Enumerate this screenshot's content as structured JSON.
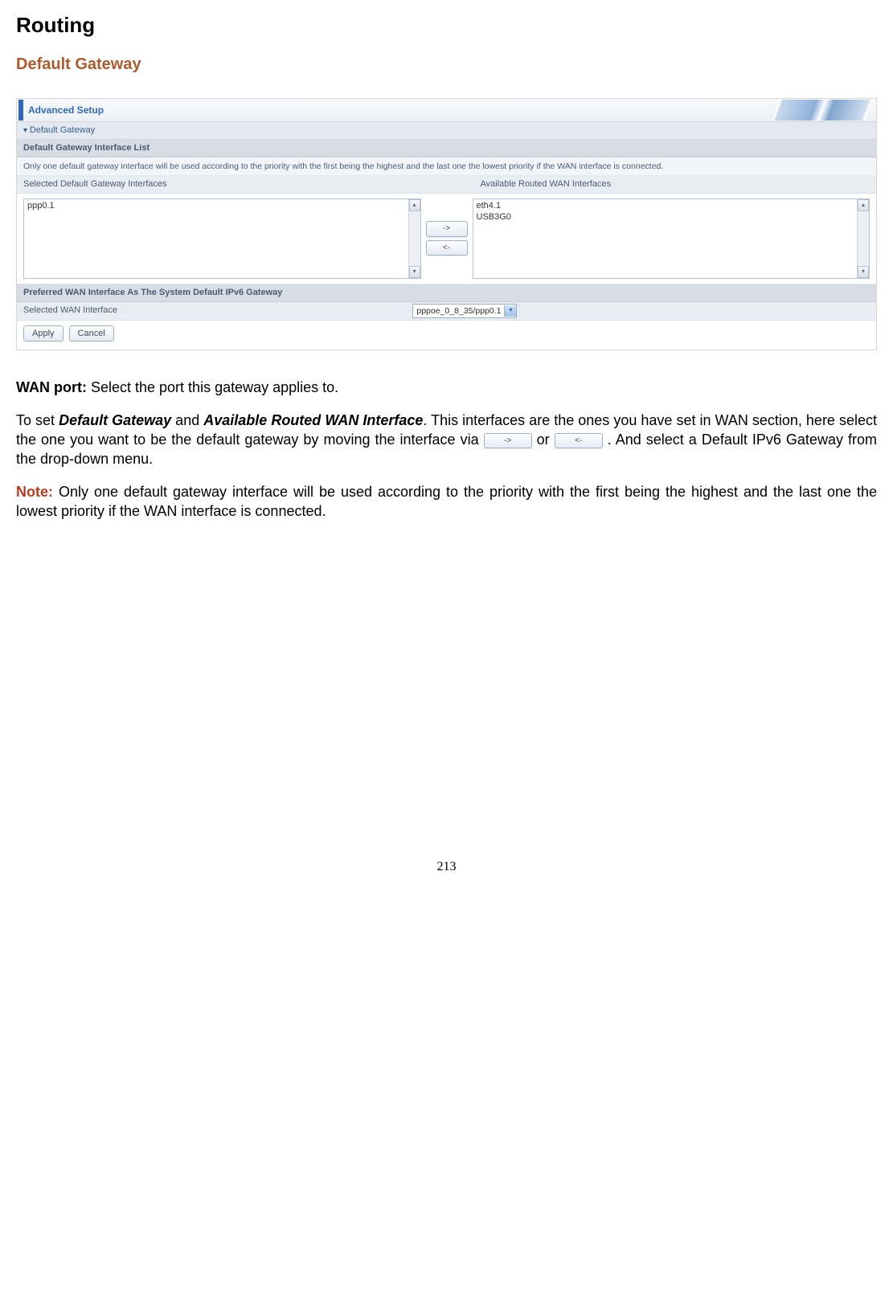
{
  "heading": "Routing",
  "subheading": "Default Gateway",
  "panel": {
    "header": "Advanced Setup",
    "section_arrow": "Default Gateway",
    "section_sub": "Default Gateway Interface List",
    "help_text": "Only one default gateway interface will be used according to the priority with the first being the highest and the last one the lowest priority if the WAN interface is connected.",
    "col_left_label": "Selected Default Gateway Interfaces",
    "col_right_label": "Available Routed WAN Interfaces",
    "left_list": [
      "ppp0.1"
    ],
    "right_list": [
      "eth4.1",
      "USB3G0"
    ],
    "btn_right": "->",
    "btn_left": "<-",
    "ipv6_section": "Preferred WAN Interface As The System Default IPv6 Gateway",
    "ipv6_label": "Selected WAN Interface",
    "ipv6_value": "pppoe_0_8_35/ppp0.1",
    "apply": "Apply",
    "cancel": "Cancel"
  },
  "body": {
    "wan_port_label": "WAN port:",
    "wan_port_text": " Select the port this gateway applies to.",
    "para2_pre": "To set ",
    "para2_dg": "Default Gateway",
    "para2_and": " and ",
    "para2_arwi": "Available Routed WAN Interface",
    "para2_mid": ". This interfaces are the ones you have set in WAN section, here select the one you want to be the default gateway by moving the interface via ",
    "para2_or": " or ",
    "para2_end": " .  And select a Default IPv6 Gateway from the drop-down menu.",
    "btn_right": "->",
    "btn_left": "<-",
    "note_label": "Note:",
    "note_text": " Only one default gateway interface will be used according to the priority with the first being the highest and the last one the lowest priority if the WAN interface is connected."
  },
  "page_number": "213"
}
